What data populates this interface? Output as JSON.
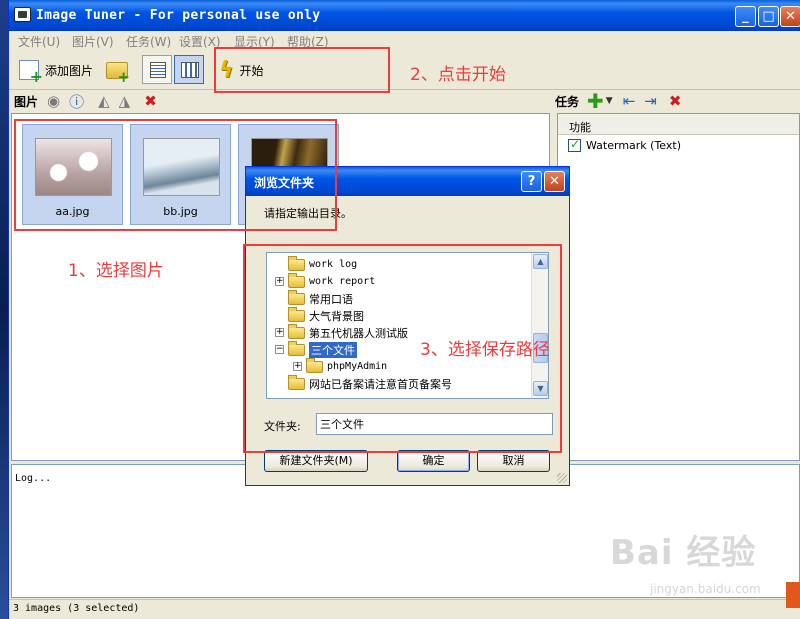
{
  "window": {
    "title": "Image Tuner - For personal use only",
    "btn_min": "_",
    "btn_max": "□",
    "btn_close": "✕"
  },
  "menu": [
    "文件(U)",
    "图片(V)",
    "任务(W)",
    "设置(X)",
    "显示(Y)",
    "帮助(Z)"
  ],
  "toolbar": {
    "add_images_label": "添加图片",
    "start_label": "开始"
  },
  "images_pane": {
    "header": "图片",
    "thumbnails": [
      {
        "caption": "aa.jpg"
      },
      {
        "caption": "bb.jpg"
      },
      {
        "caption": ""
      }
    ]
  },
  "tasks_pane": {
    "header": "任务",
    "column": "功能",
    "rows": [
      {
        "label": "Watermark (Text)",
        "checked": true
      }
    ]
  },
  "log": {
    "text": "Log..."
  },
  "status": {
    "text": "3 images (3 selected)"
  },
  "dialog": {
    "title": "浏览文件夹",
    "prompt": "请指定输出目录。",
    "help_btn": "?",
    "close_btn": "✕",
    "tree": [
      {
        "label": "work log",
        "expander": "",
        "indent": 0,
        "mono": true
      },
      {
        "label": "work report",
        "expander": "+",
        "indent": 0,
        "mono": true
      },
      {
        "label": "常用口语",
        "expander": "",
        "indent": 0
      },
      {
        "label": "大气背景图",
        "expander": "",
        "indent": 0
      },
      {
        "label": "第五代机器人测试版",
        "expander": "+",
        "indent": 0
      },
      {
        "label": "三个文件",
        "expander": "−",
        "indent": 0,
        "selected": true
      },
      {
        "label": "phpMyAdmin",
        "expander": "+",
        "indent": 1,
        "mono": true
      },
      {
        "label": "网站已备案请注意首页备案号",
        "expander": "",
        "indent": 0
      }
    ],
    "folder_label": "文件夹:",
    "folder_value": "三个文件",
    "new_folder_btn": "新建文件夹(M)",
    "ok_btn": "确定",
    "cancel_btn": "取消"
  },
  "annotations": {
    "step1": "1、选择图片",
    "step2": "2、点击开始",
    "step3": "3、选择保存路径"
  },
  "watermark": {
    "brand": "Bai 经验",
    "url": "jingyan.baidu.com"
  },
  "colors": {
    "title_bar": "#0055e5",
    "annotation_red": "#ee3b3b",
    "selection": "#316ac5"
  }
}
